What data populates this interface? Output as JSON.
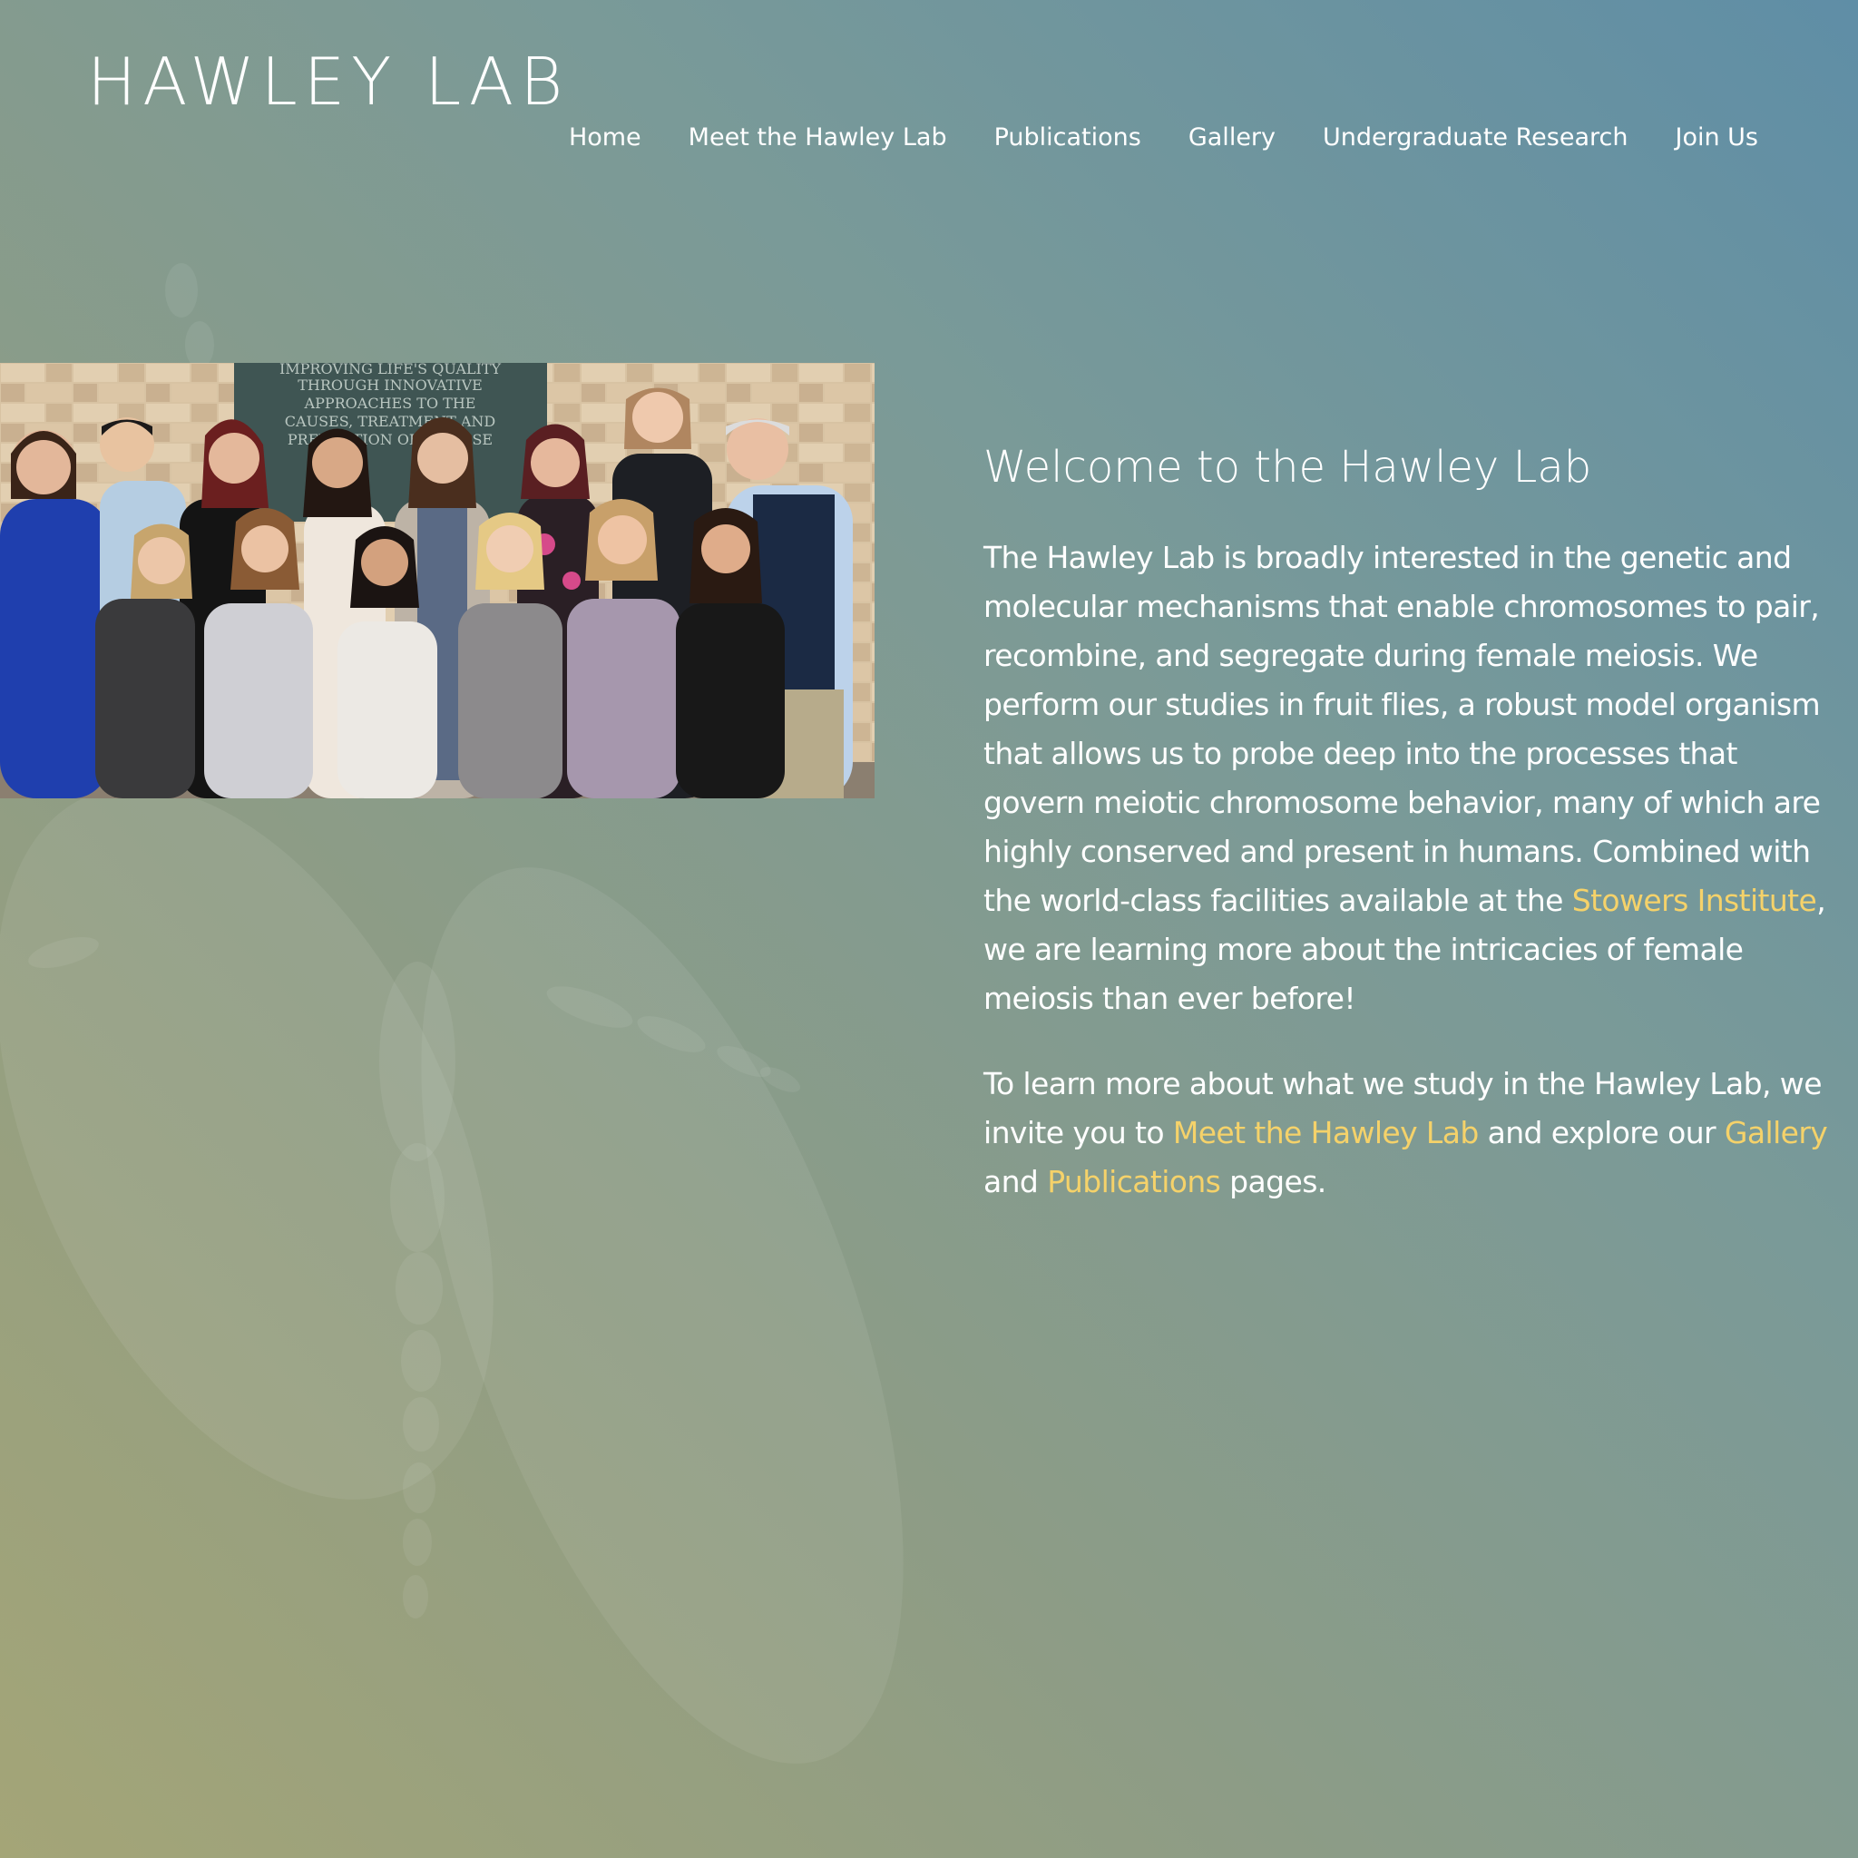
{
  "site": {
    "logo": "HAWLEY LAB"
  },
  "nav": {
    "items": [
      {
        "label": "Home"
      },
      {
        "label": "Meet the Hawley Lab"
      },
      {
        "label": "Publications"
      },
      {
        "label": "Gallery"
      },
      {
        "label": "Undergraduate Research"
      },
      {
        "label": "Join Us"
      }
    ]
  },
  "hero": {
    "photo_alt": "Hawley Lab group photo",
    "sign_lines": [
      "IMPROVING LIFE'S QUALITY",
      "THROUGH INNOVATIVE",
      "APPROACHES TO THE",
      "CAUSES, TREATMENT AND",
      "PREVENTION OF DISEASE"
    ]
  },
  "main": {
    "heading": "Welcome to the Hawley Lab",
    "p1_before": "The Hawley Lab is broadly interested in the genetic and molecular mechanisms that enable chromosomes to pair, recombine, and segregate during female meiosis. We perform our studies in fruit flies, a robust model organism that allows us to probe deep into the processes that govern meiotic chromosome behavior, many of which are highly conserved and present in humans. Combined with the world-class facilities available at the ",
    "p1_link": "Stowers Institute",
    "p1_after": ", we are learning more about the intricacies of female meiosis than ever before!",
    "p2_before": "To learn more about what we study in the Hawley Lab, we invite you to ",
    "p2_link1": "Meet the Hawley Lab",
    "p2_mid1": " and explore our ",
    "p2_link2": "Gallery",
    "p2_mid2": " and ",
    "p2_link3": "Publications",
    "p2_after": " pages."
  },
  "colors": {
    "link": "#f5d26a",
    "text": "#ffffff",
    "bg_top_right": "#5f8ea6",
    "bg_bottom_left": "#a4a577"
  }
}
